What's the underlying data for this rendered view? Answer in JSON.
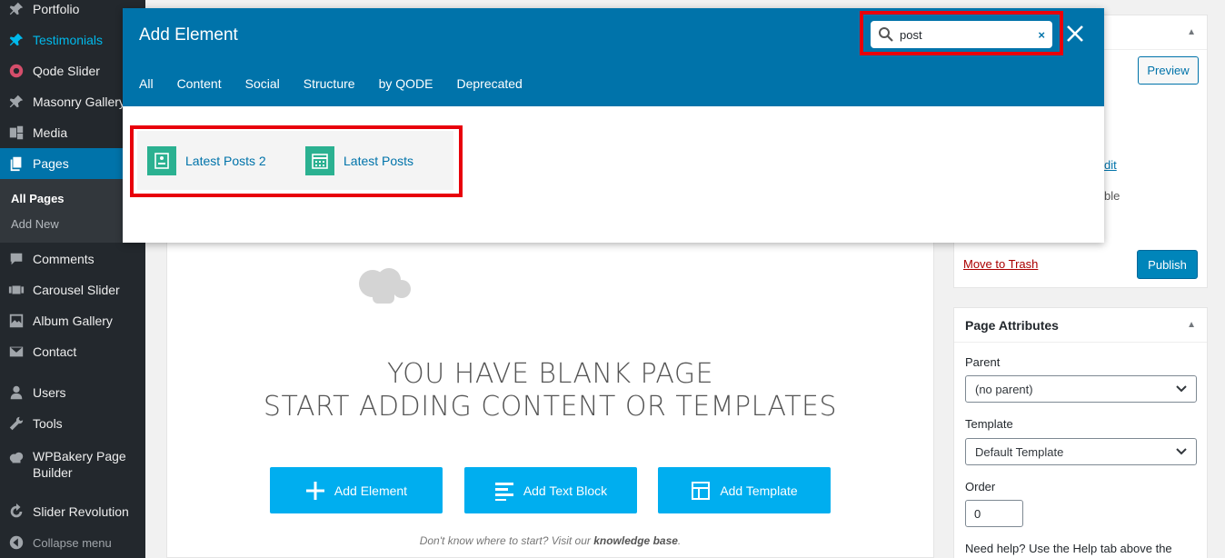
{
  "sidebar": {
    "items": [
      {
        "label": "Portfolio",
        "icon": "pin-icon"
      },
      {
        "label": "Testimonials",
        "icon": "pin-icon"
      },
      {
        "label": "Qode Slider",
        "icon": "circle-icon"
      },
      {
        "label": "Masonry Gallery",
        "icon": "pin-icon"
      },
      {
        "label": "Media",
        "icon": "media-icon"
      },
      {
        "label": "Pages",
        "icon": "pages-icon"
      },
      {
        "label": "Comments",
        "icon": "comment-icon"
      },
      {
        "label": "Carousel Slider",
        "icon": "slides-icon"
      },
      {
        "label": "Album Gallery",
        "icon": "gallery-icon"
      },
      {
        "label": "Contact",
        "icon": "email-icon"
      },
      {
        "label": "Users",
        "icon": "users-icon"
      },
      {
        "label": "Tools",
        "icon": "wrench-icon"
      },
      {
        "label": "WPBakery Page Builder",
        "icon": "wpbakery-icon"
      },
      {
        "label": "Slider Revolution",
        "icon": "refresh-icon"
      },
      {
        "label": "Collapse menu",
        "icon": "collapse-icon"
      }
    ],
    "submenu": [
      "All Pages",
      "Add New"
    ]
  },
  "modal": {
    "title": "Add Element",
    "search_value": "post",
    "clear_symbol": "×",
    "tabs": [
      "All",
      "Content",
      "Social",
      "Structure",
      "by QODE",
      "Deprecated"
    ],
    "results": [
      "Latest Posts 2",
      "Latest Posts"
    ]
  },
  "editor": {
    "blank_line1": "YOU HAVE BLANK PAGE",
    "blank_line2": "START ADDING CONTENT OR TEMPLATES",
    "add_element": "Add Element",
    "add_text_block": "Add Text Block",
    "add_template": "Add Template",
    "hint_prefix": "Don't know where to start? Visit our ",
    "hint_link": "knowledge base",
    "hint_suffix": "."
  },
  "publish_box": {
    "toggle": "▲",
    "preview": "Preview",
    "partial_edit": "dit",
    "partial_able": "ble",
    "move_to_trash": "Move to Trash",
    "publish": "Publish"
  },
  "attributes": {
    "title": "Page Attributes",
    "toggle": "▲",
    "parent_label": "Parent",
    "parent_value": "(no parent)",
    "template_label": "Template",
    "template_value": "Default Template",
    "order_label": "Order",
    "order_value": "0",
    "help": "Need help? Use the Help tab above the"
  },
  "colors": {
    "accent": "#0073aa",
    "button": "#00aeef",
    "element_icon": "#2bb191",
    "highlight_frame": "#e8000b"
  }
}
